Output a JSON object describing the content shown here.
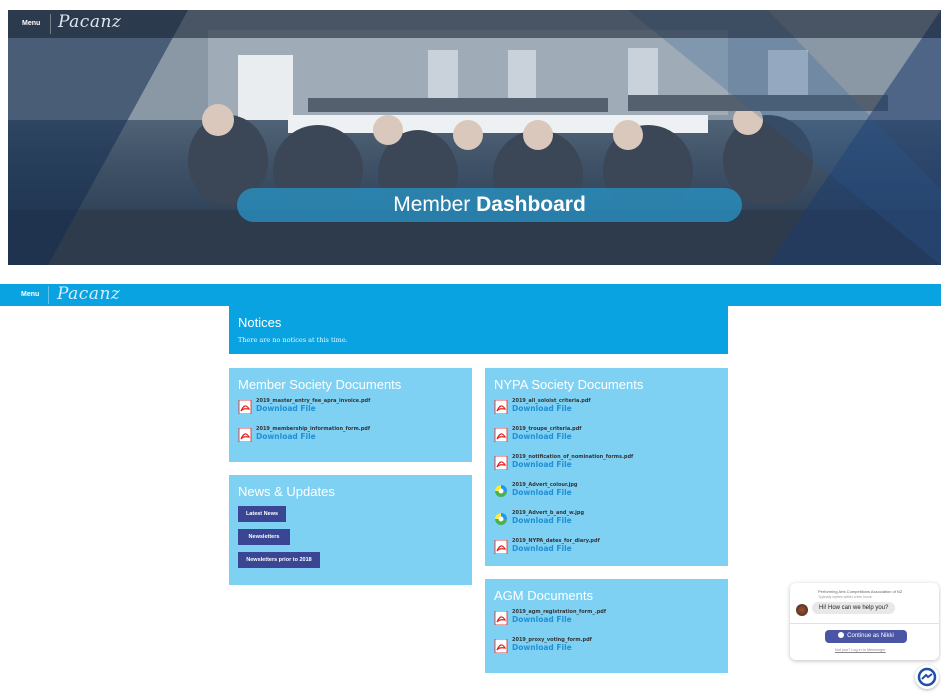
{
  "header": {
    "menu_label": "Menu",
    "logo_text": "Pacanz"
  },
  "hero": {
    "title_light": "Member",
    "title_bold": "Dashboard"
  },
  "nav": {
    "menu_label": "Menu",
    "logo_text": "Pacanz"
  },
  "notices": {
    "title": "Notices",
    "text": "There are no notices at this time."
  },
  "member_docs": {
    "title": "Member Society Documents",
    "files": [
      {
        "name": "2019_master_entry_fee_apra_invoice.pdf",
        "link": "Download File",
        "icon": "pdf-icon"
      },
      {
        "name": "2019_membership_information_form.pdf",
        "link": "Download File",
        "icon": "pdf-icon"
      }
    ]
  },
  "nypa_docs": {
    "title": "NYPA Society Documents",
    "files": [
      {
        "name": "2019_all_soloist_criteria.pdf",
        "link": "Download File",
        "icon": "pdf-icon"
      },
      {
        "name": "2019_troupe_criteria.pdf",
        "link": "Download File",
        "icon": "pdf-icon"
      },
      {
        "name": "2019_notification_of_nomination_forms.pdf",
        "link": "Download File",
        "icon": "pdf-icon"
      },
      {
        "name": "2019_Advert_colour.jpg",
        "link": "Download File",
        "icon": "image-icon"
      },
      {
        "name": "2019_Advert_b_and_w.jpg",
        "link": "Download File",
        "icon": "image-icon"
      },
      {
        "name": "2019_NYPA_dates_for_diary.pdf",
        "link": "Download File",
        "icon": "pdf-icon"
      }
    ]
  },
  "news": {
    "title": "News & Updates",
    "buttons": [
      "Latest News",
      "Newsletters",
      "Newsletters prior to 2018"
    ]
  },
  "agm_docs": {
    "title": "AGM Documents",
    "files": [
      {
        "name": "2019_agm_registration_form_.pdf",
        "link": "Download File",
        "icon": "pdf-icon"
      },
      {
        "name": "2019_proxy_voting_form.pdf",
        "link": "Download File",
        "icon": "pdf-icon"
      }
    ]
  },
  "chat": {
    "org": "Performing Arts Competitions Association of NZ",
    "sub": "Typically replies within a few hours",
    "greeting": "Hi! How can we help you?",
    "continue": "Continue as Nikki",
    "not_you": "Not you? Log in to Messenger"
  },
  "colors": {
    "accent": "#0aa3e2",
    "panel_light": "#7fd1f3",
    "button": "#3a4694",
    "link": "#1f8fd6"
  }
}
